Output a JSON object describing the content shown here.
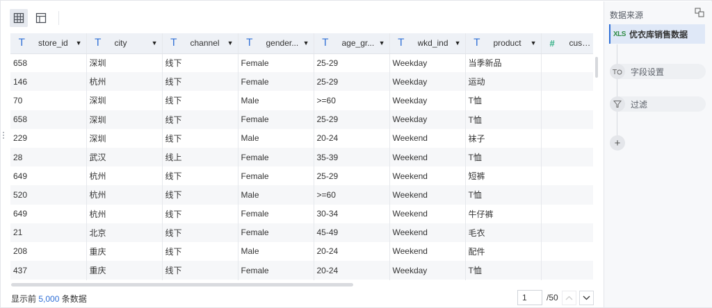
{
  "toolbar": {
    "grid_view_icon": "table-grid-icon",
    "layout_view_icon": "layout-icon"
  },
  "table": {
    "columns": [
      {
        "type": "text",
        "label": "store_id"
      },
      {
        "type": "text",
        "label": "city"
      },
      {
        "type": "text",
        "label": "channel"
      },
      {
        "type": "text",
        "label": "gender..."
      },
      {
        "type": "text",
        "label": "age_gr..."
      },
      {
        "type": "text",
        "label": "wkd_ind"
      },
      {
        "type": "text",
        "label": "product"
      },
      {
        "type": "number",
        "label": "customer"
      }
    ],
    "rows": [
      [
        "658",
        "深圳",
        "线下",
        "Female",
        "25-29",
        "Weekday",
        "当季新品",
        ""
      ],
      [
        "146",
        "杭州",
        "线下",
        "Female",
        "25-29",
        "Weekday",
        "运动",
        ""
      ],
      [
        "70",
        "深圳",
        "线下",
        "Male",
        ">=60",
        "Weekday",
        "T恤",
        ""
      ],
      [
        "658",
        "深圳",
        "线下",
        "Female",
        "25-29",
        "Weekday",
        "T恤",
        ""
      ],
      [
        "229",
        "深圳",
        "线下",
        "Male",
        "20-24",
        "Weekend",
        "袜子",
        ""
      ],
      [
        "28",
        "武汉",
        "线上",
        "Female",
        "35-39",
        "Weekend",
        "T恤",
        ""
      ],
      [
        "649",
        "杭州",
        "线下",
        "Female",
        "25-29",
        "Weekend",
        "短裤",
        ""
      ],
      [
        "520",
        "杭州",
        "线下",
        "Male",
        ">=60",
        "Weekend",
        "T恤",
        ""
      ],
      [
        "649",
        "杭州",
        "线下",
        "Female",
        "30-34",
        "Weekend",
        "牛仔裤",
        ""
      ],
      [
        "21",
        "北京",
        "线下",
        "Female",
        "45-49",
        "Weekend",
        "毛衣",
        ""
      ],
      [
        "208",
        "重庆",
        "线下",
        "Male",
        "20-24",
        "Weekend",
        "配件",
        ""
      ],
      [
        "437",
        "重庆",
        "线下",
        "Female",
        "20-24",
        "Weekday",
        "T恤",
        ""
      ],
      [
        "",
        "",
        "",
        "",
        "",
        "",
        "",
        ""
      ]
    ]
  },
  "footer": {
    "prefix": "显示前",
    "count": "5,000",
    "suffix": "条数据",
    "page_value": "1",
    "page_total": "/50"
  },
  "panel": {
    "title": "数据来源",
    "source_badge": "XLS",
    "source_name": "优衣库销售数据",
    "steps": [
      {
        "label": "字段设置",
        "icon": "field-settings-icon"
      },
      {
        "label": "过滤",
        "icon": "filter-icon"
      }
    ],
    "add_label": "+"
  },
  "colors": {
    "accent": "#2f6fd6",
    "number_type": "#2fae83",
    "header_bg": "#eef1f6",
    "selected_bg": "#dfe8f7"
  }
}
